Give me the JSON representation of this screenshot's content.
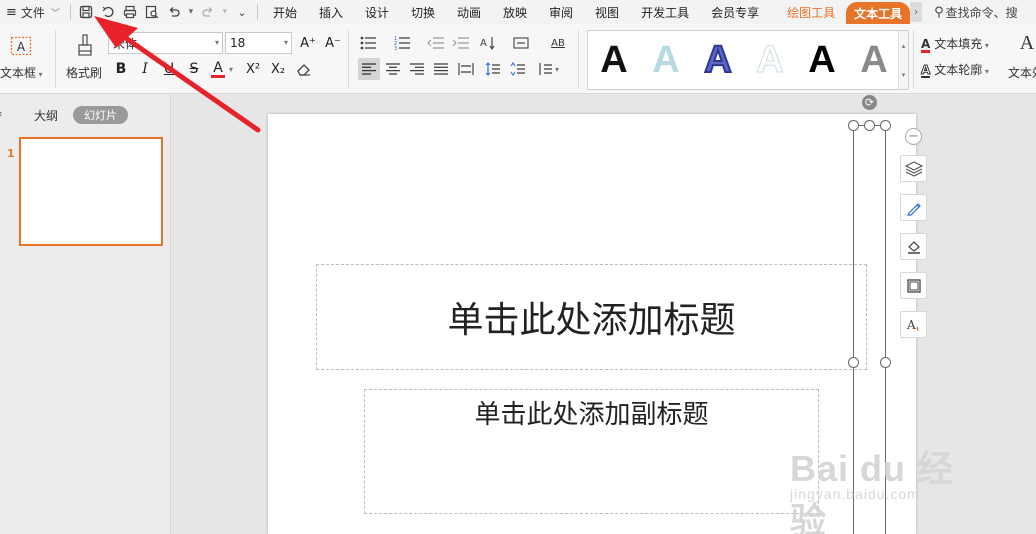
{
  "menubar": {
    "menu_icon": "≡",
    "file_label": "文件",
    "tabs": [
      "开始",
      "插入",
      "设计",
      "切换",
      "动画",
      "放映",
      "审阅",
      "视图",
      "开发工具",
      "会员专享"
    ],
    "context_tab": "绘图工具",
    "active_tab": "文本工具",
    "search_text": "查找命令、搜"
  },
  "ribbon": {
    "textbox_label": "文本框",
    "format_painter_label": "格式刷",
    "font_name": "宋体",
    "font_size": "18",
    "bold": "B",
    "italic": "I",
    "underline": "U",
    "strike": "S",
    "font_color": "A",
    "superscript": "X²",
    "subscript": "X₂",
    "grow_font": "A⁺",
    "shrink_font": "A⁻",
    "ab_label": "AB",
    "text_fill_label": "文本填充",
    "text_outline_label": "文本轮廓",
    "text_effect_label": "文本效",
    "gallery_letter": "A"
  },
  "leftpanel": {
    "outline_tab": "大纲",
    "slides_tab": "幻灯片",
    "slide_number": "1"
  },
  "slide": {
    "title_placeholder": "单击此处添加标题",
    "subtitle_placeholder": "单击此处添加副标题"
  },
  "watermark": {
    "brand": "Bai du 经验",
    "url": "jingyan.baidu.com"
  },
  "colors": {
    "accent": "#e8742a",
    "arrow": "#e8222a"
  }
}
